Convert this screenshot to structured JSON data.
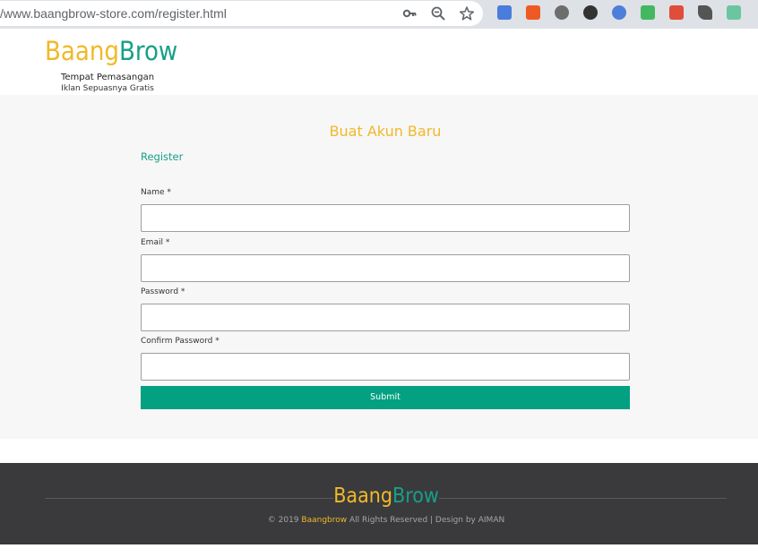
{
  "browser": {
    "url": "/www.baangbrow-store.com/register.html",
    "extensions": [
      {
        "name": "translate-icon",
        "color": "#4a7cdb"
      },
      {
        "name": "percent-icon",
        "color": "#ef5a24"
      },
      {
        "name": "settings-gear-icon",
        "color": "#6d6d6d"
      },
      {
        "name": "dark-circle-icon",
        "color": "#333333"
      },
      {
        "name": "sync-icon",
        "color": "#4d7fd8"
      },
      {
        "name": "shield-check-icon",
        "color": "#43b860"
      },
      {
        "name": "bars-icon",
        "color": "#e04d3b"
      },
      {
        "name": "rocket-icon",
        "color": "#555555"
      },
      {
        "name": "puzzle-icon",
        "color": "#6bc5a0"
      }
    ]
  },
  "header": {
    "logo_part1": "Baang",
    "logo_part2": "Brow",
    "tagline1": "Tempat Pemasangan",
    "tagline2": "Iklan Sepuasnya Gratis"
  },
  "form": {
    "title": "Buat Akun Baru",
    "subtitle": "Register",
    "fields": [
      {
        "label": "Name *",
        "value": ""
      },
      {
        "label": "Email *",
        "value": ""
      },
      {
        "label": "Password *",
        "value": ""
      },
      {
        "label": "Confirm Password *",
        "value": ""
      }
    ],
    "submit_label": "Submit"
  },
  "footer": {
    "logo_part1": "Baang",
    "logo_part2": "Brow",
    "copy_prefix": "© 2019",
    "copy_brand": "Baangbrow",
    "copy_suffix": "All Rights Reserved | Design by AIMAN"
  },
  "colors": {
    "brand_yellow": "#f0b928",
    "brand_green": "#17a085",
    "button_green": "#03a081",
    "footer_bg": "#3a3a3d"
  }
}
